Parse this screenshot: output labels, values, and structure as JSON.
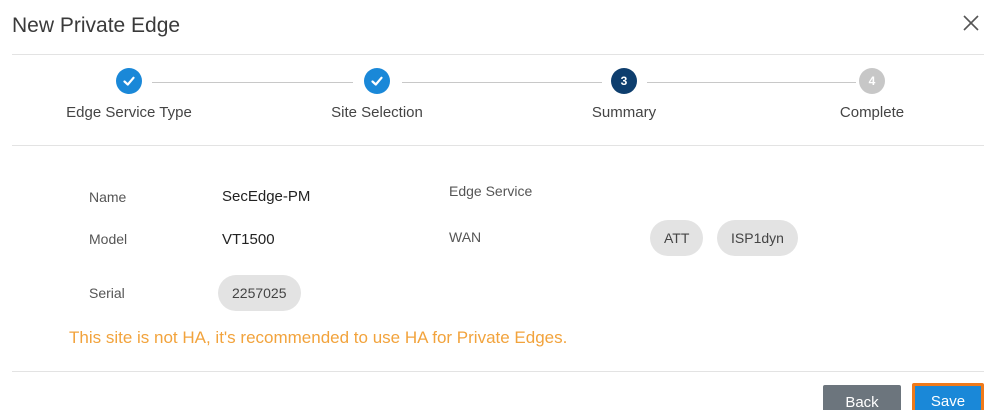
{
  "dialog": {
    "title": "New Private Edge"
  },
  "steps": [
    {
      "label": "Edge Service Type",
      "state": "done",
      "number": "1"
    },
    {
      "label": "Site Selection",
      "state": "done",
      "number": "2"
    },
    {
      "label": "Summary",
      "state": "current",
      "number": "3"
    },
    {
      "label": "Complete",
      "state": "pending",
      "number": "4"
    }
  ],
  "summary": {
    "name_label": "Name",
    "name_value": "SecEdge-PM",
    "model_label": "Model",
    "model_value": "VT1500",
    "serial_label": "Serial",
    "serial_value": "2257025",
    "edge_service_label": "Edge Service",
    "wan_label": "WAN",
    "wan_chips": [
      "ATT",
      "ISP1dyn"
    ]
  },
  "warning": "This site is not HA, it's recommended to use HA for Private Edges.",
  "buttons": {
    "back_label": "Back",
    "save_label": "Save"
  },
  "colors": {
    "accent": "#1a88d8",
    "current_step": "#0e3e6e",
    "pending_step": "#c7c7c7",
    "warning": "#f2a33c",
    "back_button": "#6c757d",
    "focus_ring": "#f07a1a"
  }
}
